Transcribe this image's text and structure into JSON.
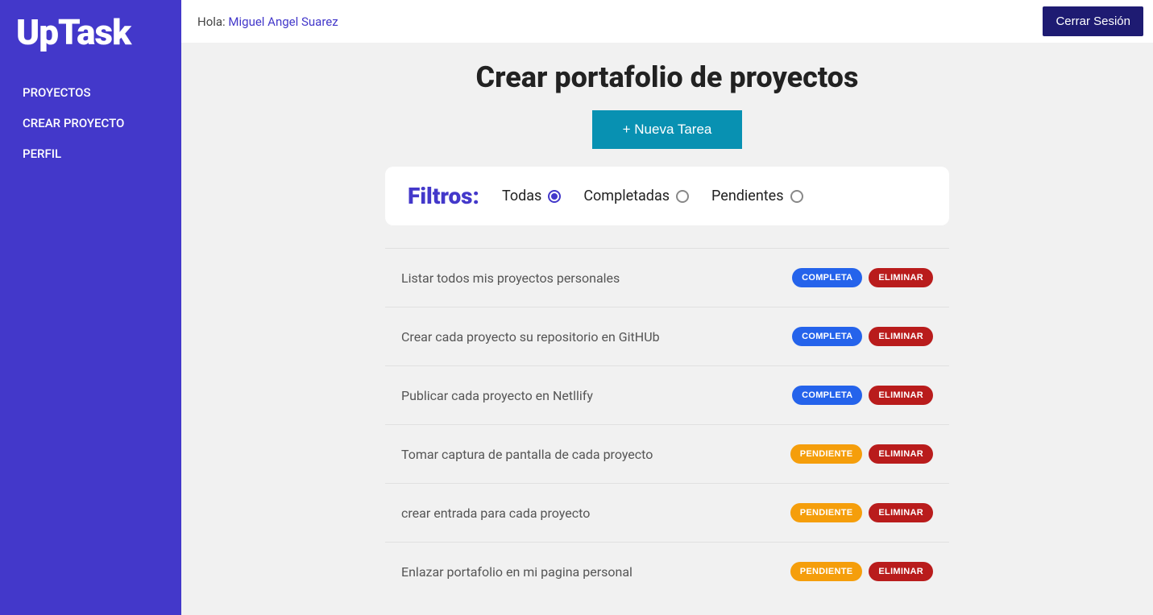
{
  "app": {
    "logo": "UpTask"
  },
  "sidebar": {
    "items": [
      {
        "label": "PROYECTOS"
      },
      {
        "label": "CREAR PROYECTO"
      },
      {
        "label": "PERFIL"
      }
    ]
  },
  "header": {
    "greeting_prefix": "Hola: ",
    "username": "Miguel Angel Suarez",
    "logout_label": "Cerrar Sesión"
  },
  "page": {
    "title": "Crear portafolio de proyectos",
    "new_task_label": "+ Nueva Tarea"
  },
  "filters": {
    "label": "Filtros:",
    "options": [
      {
        "label": "Todas",
        "selected": true
      },
      {
        "label": "Completadas",
        "selected": false
      },
      {
        "label": "Pendientes",
        "selected": false
      }
    ]
  },
  "status_labels": {
    "completa": "COMPLETA",
    "pendiente": "PENDIENTE",
    "eliminar": "ELIMINAR"
  },
  "tasks": [
    {
      "title": "Listar todos mis proyectos personales",
      "status": "completa"
    },
    {
      "title": "Crear cada proyecto su repositorio en GitHUb",
      "status": "completa"
    },
    {
      "title": "Publicar cada proyecto en Netllify",
      "status": "completa"
    },
    {
      "title": "Tomar captura de pantalla de cada proyecto",
      "status": "pendiente"
    },
    {
      "title": "crear entrada para cada proyecto",
      "status": "pendiente"
    },
    {
      "title": "Enlazar portafolio en mi pagina personal",
      "status": "pendiente"
    }
  ]
}
